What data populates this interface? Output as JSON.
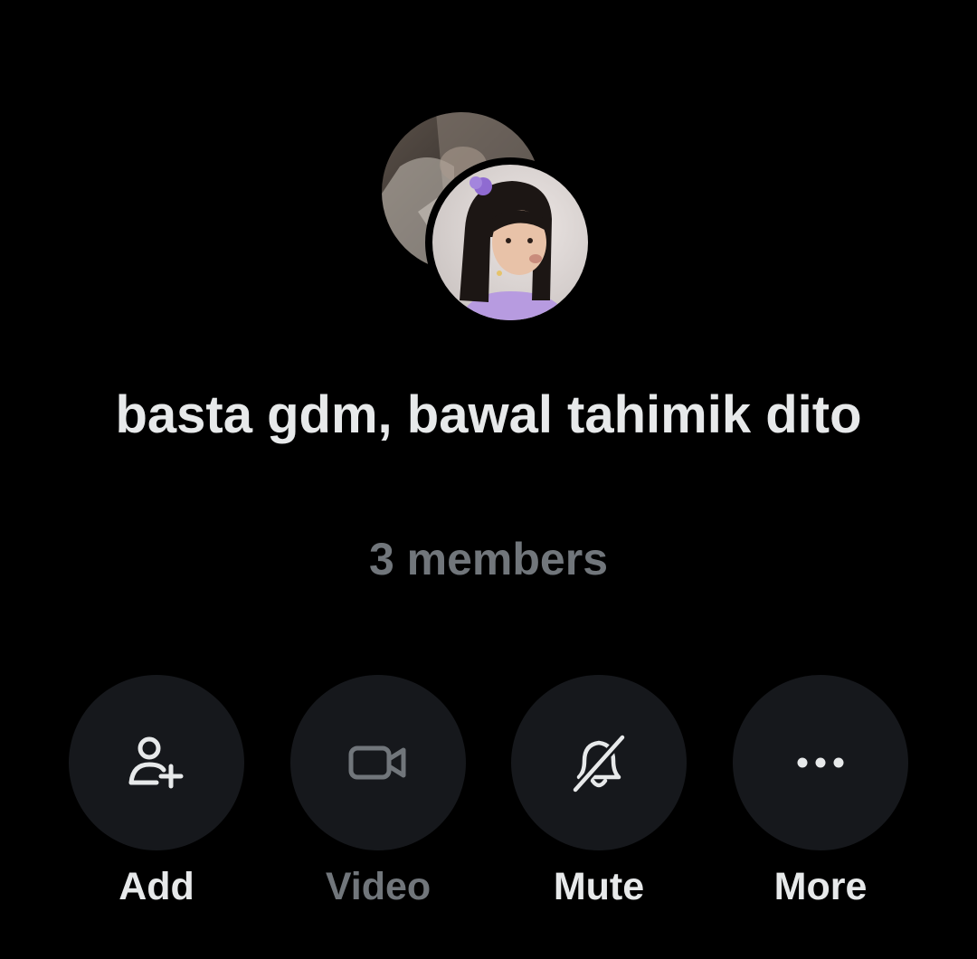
{
  "conversation": {
    "title": "basta gdm, bawal tahimik dito",
    "member_count": "3 members"
  },
  "avatars": [
    {
      "name": "member-avatar-1",
      "description": "photo"
    },
    {
      "name": "member-avatar-2",
      "description": "photo"
    }
  ],
  "actions": [
    {
      "id": "add",
      "label": "Add",
      "icon": "add-person-icon",
      "enabled": true
    },
    {
      "id": "video",
      "label": "Video",
      "icon": "video-camera-icon",
      "enabled": false
    },
    {
      "id": "mute",
      "label": "Mute",
      "icon": "bell-muted-icon",
      "enabled": true
    },
    {
      "id": "more",
      "label": "More",
      "icon": "more-dots-icon",
      "enabled": true
    }
  ],
  "colors": {
    "background": "#000000",
    "primary_text": "#e7e9ea",
    "secondary_text": "#71767b",
    "button_fill": "#16181c"
  }
}
